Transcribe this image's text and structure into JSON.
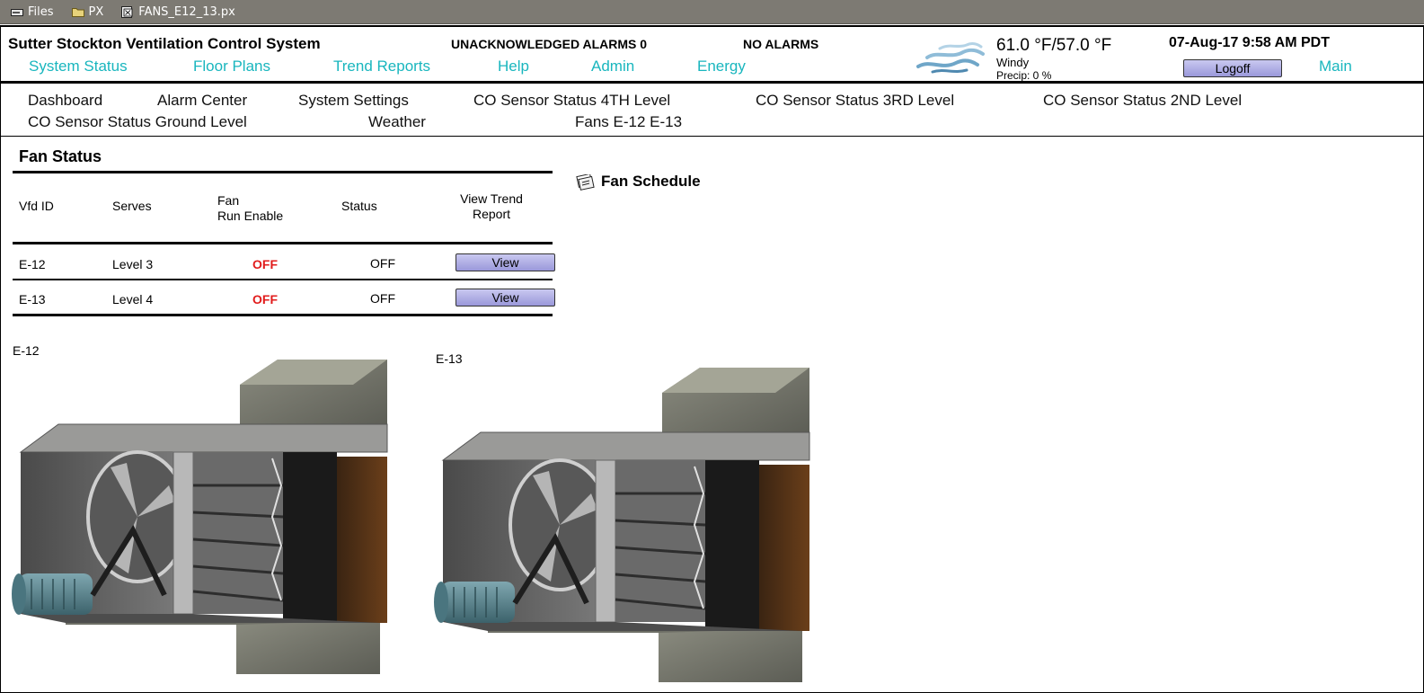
{
  "pathbar": [
    {
      "label": "Files",
      "icon": "drive-icon"
    },
    {
      "label": "PX",
      "icon": "folder-icon"
    },
    {
      "label": "FANS_E12_13.px",
      "icon": "px-file-icon"
    }
  ],
  "header": {
    "title": "Sutter Stockton Ventilation Control System",
    "unack_alarms": "UNACKNOWLEDGED ALARMS 0",
    "alarm_status": "NO ALARMS",
    "datetime": "07-Aug-17 9:58 AM PDT",
    "logoff_label": "Logoff",
    "main_label": "Main"
  },
  "weather": {
    "icon": "wind-icon",
    "temperature": "61.0 °F/57.0 °F",
    "condition": "Windy",
    "precip": "Precip: 0 %"
  },
  "topnav": [
    "System Status",
    "Floor Plans",
    "Trend Reports",
    "Help",
    "Admin",
    "Energy"
  ],
  "subnav": [
    "Dashboard",
    "Alarm Center",
    "System Settings",
    "CO Sensor Status 4TH Level",
    "CO Sensor Status 3RD Level",
    "CO Sensor Status 2ND Level",
    "CO Sensor Status Ground Level",
    "Weather",
    "Fans E-12 E-13"
  ],
  "fan_status": {
    "title": "Fan Status",
    "columns": {
      "vfd_id": "Vfd ID",
      "serves": "Serves",
      "fan_line1": "Fan",
      "fan_line2": "Run Enable",
      "status": "Status",
      "trend_line1": "View Trend",
      "trend_line2": "Report"
    },
    "rows": [
      {
        "vfd_id": "E-12",
        "serves": "Level 3",
        "run_enable": "OFF",
        "status": "OFF",
        "action": "View"
      },
      {
        "vfd_id": "E-13",
        "serves": "Level 4",
        "run_enable": "OFF",
        "status": "OFF",
        "action": "View"
      }
    ]
  },
  "fan_schedule": {
    "label": "Fan Schedule",
    "icon": "schedule-icon"
  },
  "graphics": [
    {
      "label": "E-12"
    },
    {
      "label": "E-13"
    }
  ],
  "colors": {
    "nav_link": "#19b6be",
    "alarm_red": "#e11b1b",
    "button_fill": "#aeacde"
  }
}
